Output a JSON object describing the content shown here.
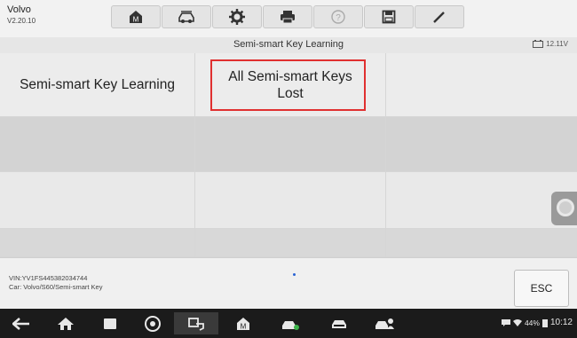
{
  "app": {
    "name": "Volvo",
    "version": "V2.20.10"
  },
  "toolbar": {
    "buttons": [
      "home-icon",
      "vehicle-swap-icon",
      "settings-gear-icon",
      "print-icon",
      "help-icon",
      "save-icon",
      "edit-icon"
    ]
  },
  "subtitle": "Semi-smart Key Learning",
  "battery_voltage": "12.11V",
  "menu": {
    "rows": [
      [
        "Semi-smart Key Learning",
        "All Semi-smart Keys Lost",
        ""
      ],
      [
        "",
        "",
        ""
      ],
      [
        "",
        "",
        ""
      ],
      [
        "",
        "",
        ""
      ]
    ]
  },
  "info": {
    "vin": "VIN:YV1FS445382034744",
    "car": "Car: Volvo/S60/Semi-smart Key"
  },
  "esc_label": "ESC",
  "status": {
    "battery": "44%",
    "time": "10:12"
  },
  "colors": {
    "highlight": "#e03030",
    "navbar": "#1b1b1b"
  }
}
